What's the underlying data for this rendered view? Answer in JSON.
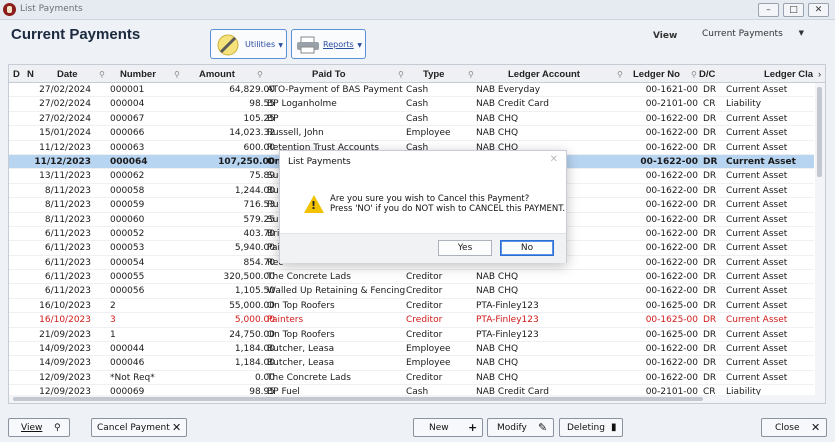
{
  "window": {
    "title": "List Payments",
    "controls": [
      "minimize",
      "maximize",
      "close"
    ]
  },
  "header": {
    "title": "Current Payments",
    "utilities_label": "Utilities",
    "reports_label": "Reports",
    "view_label": "View",
    "view_value": "Current Payments"
  },
  "columns": [
    "D",
    "N",
    "Date",
    "Number",
    "Amount",
    "Paid To",
    "Type",
    "Ledger Account",
    "Ledger No",
    "D/C",
    "Ledger Cla"
  ],
  "rows": [
    {
      "date": "27/02/2024",
      "number": "000001",
      "amount": "64,829.00",
      "paid_to": "ATO-Payment of BAS Payment",
      "type": "Cash",
      "ledger": "NAB Everyday",
      "ledger_no": "00-1621-00",
      "dc": "DR",
      "cls": "Current Asset",
      "state": "normal"
    },
    {
      "date": "27/02/2024",
      "number": "000004",
      "amount": "98.55",
      "paid_to": "BP Loganholme",
      "type": "Cash",
      "ledger": "NAB Credit Card",
      "ledger_no": "00-2101-00",
      "dc": "CR",
      "cls": "Liability",
      "state": "normal"
    },
    {
      "date": "27/02/2024",
      "number": "000067",
      "amount": "105.25",
      "paid_to": "BP",
      "type": "Cash",
      "ledger": "NAB CHQ",
      "ledger_no": "00-1622-00",
      "dc": "DR",
      "cls": "Current Asset",
      "state": "normal"
    },
    {
      "date": "15/01/2024",
      "number": "000066",
      "amount": "14,023.32",
      "paid_to": "Russell, John",
      "type": "Employee",
      "ledger": "NAB CHQ",
      "ledger_no": "00-1622-00",
      "dc": "DR",
      "cls": "Current Asset",
      "state": "normal"
    },
    {
      "date": "11/12/2023",
      "number": "000063",
      "amount": "600.00",
      "paid_to": "Retention Trust Accounts",
      "type": "Cash",
      "ledger": "NAB CHQ",
      "ledger_no": "00-1622-00",
      "dc": "DR",
      "cls": "Current Asset",
      "state": "normal"
    },
    {
      "date": "11/12/2023",
      "number": "000064",
      "amount": "107,250.00",
      "paid_to": "On",
      "type": "",
      "ledger": "",
      "ledger_no": "00-1622-00",
      "dc": "DR",
      "cls": "Current Asset",
      "state": "selected"
    },
    {
      "date": "13/11/2023",
      "number": "000062",
      "amount": "75.89",
      "paid_to": "Sur",
      "type": "",
      "ledger": "",
      "ledger_no": "00-1622-00",
      "dc": "DR",
      "cls": "Current Asset",
      "state": "normal"
    },
    {
      "date": "8/11/2023",
      "number": "000058",
      "amount": "1,244.00",
      "paid_to": "But",
      "type": "",
      "ledger": "",
      "ledger_no": "00-1622-00",
      "dc": "DR",
      "cls": "Current Asset",
      "state": "normal"
    },
    {
      "date": "8/11/2023",
      "number": "000059",
      "amount": "716.53",
      "paid_to": "Rus",
      "type": "",
      "ledger": "",
      "ledger_no": "00-1622-00",
      "dc": "DR",
      "cls": "Current Asset",
      "state": "normal"
    },
    {
      "date": "8/11/2023",
      "number": "000060",
      "amount": "579.25",
      "paid_to": "Sur",
      "type": "",
      "ledger": "",
      "ledger_no": "00-1622-00",
      "dc": "DR",
      "cls": "Current Asset",
      "state": "normal"
    },
    {
      "date": "6/11/2023",
      "number": "000052",
      "amount": "403.70",
      "paid_to": "Bri",
      "type": "",
      "ledger": "",
      "ledger_no": "00-1622-00",
      "dc": "DR",
      "cls": "Current Asset",
      "state": "normal"
    },
    {
      "date": "6/11/2023",
      "number": "000053",
      "amount": "5,940.00",
      "paid_to": "Pai",
      "type": "",
      "ledger": "",
      "ledger_no": "00-1622-00",
      "dc": "DR",
      "cls": "Current Asset",
      "state": "normal"
    },
    {
      "date": "6/11/2023",
      "number": "000054",
      "amount": "854.70",
      "paid_to": "Rec",
      "type": "",
      "ledger": "",
      "ledger_no": "00-1622-00",
      "dc": "DR",
      "cls": "Current Asset",
      "state": "normal"
    },
    {
      "date": "6/11/2023",
      "number": "000055",
      "amount": "320,500.00",
      "paid_to": "The Concrete Lads",
      "type": "Creditor",
      "ledger": "NAB CHQ",
      "ledger_no": "00-1622-00",
      "dc": "DR",
      "cls": "Current Asset",
      "state": "normal"
    },
    {
      "date": "6/11/2023",
      "number": "000056",
      "amount": "1,105.50",
      "paid_to": "Walled Up Retaining & Fencing",
      "type": "Creditor",
      "ledger": "NAB CHQ",
      "ledger_no": "00-1622-00",
      "dc": "DR",
      "cls": "Current Asset",
      "state": "normal"
    },
    {
      "date": "16/10/2023",
      "number": "2",
      "amount": "55,000.00",
      "paid_to": "On Top Roofers",
      "type": "Creditor",
      "ledger": "PTA-Finley123",
      "ledger_no": "00-1625-00",
      "dc": "DR",
      "cls": "Current Asset",
      "state": "normal"
    },
    {
      "date": "16/10/2023",
      "number": "3",
      "amount": "5,000.00",
      "paid_to": "Painters",
      "type": "Creditor",
      "ledger": "PTA-Finley123",
      "ledger_no": "00-1625-00",
      "dc": "DR",
      "cls": "Current Asset",
      "state": "cancelled"
    },
    {
      "date": "21/09/2023",
      "number": "1",
      "amount": "24,750.00",
      "paid_to": "On Top Roofers",
      "type": "Creditor",
      "ledger": "PTA-Finley123",
      "ledger_no": "00-1625-00",
      "dc": "DR",
      "cls": "Current Asset",
      "state": "normal"
    },
    {
      "date": "14/09/2023",
      "number": "000044",
      "amount": "1,184.00",
      "paid_to": "Butcher, Leasa",
      "type": "Employee",
      "ledger": "NAB CHQ",
      "ledger_no": "00-1622-00",
      "dc": "DR",
      "cls": "Current Asset",
      "state": "normal"
    },
    {
      "date": "14/09/2023",
      "number": "000046",
      "amount": "1,184.00",
      "paid_to": "Butcher, Leasa",
      "type": "Employee",
      "ledger": "NAB CHQ",
      "ledger_no": "00-1622-00",
      "dc": "DR",
      "cls": "Current Asset",
      "state": "normal"
    },
    {
      "date": "12/09/2023",
      "number": "*Not Req*",
      "amount": "0.00",
      "paid_to": "The Concrete Lads",
      "type": "Creditor",
      "ledger": "NAB CHQ",
      "ledger_no": "00-1622-00",
      "dc": "DR",
      "cls": "Current Asset",
      "state": "normal"
    },
    {
      "date": "12/09/2023",
      "number": "000069",
      "amount": "98.95",
      "paid_to": "BP Fuel",
      "type": "Cash",
      "ledger": "NAB Credit Card",
      "ledger_no": "00-2101-00",
      "dc": "CR",
      "cls": "Liability",
      "state": "normal"
    }
  ],
  "footer": {
    "view": "View",
    "cancel_payment": "Cancel Payment",
    "new": "New",
    "modify": "Modify",
    "deleting": "Deleting",
    "close": "Close"
  },
  "dialog": {
    "title": "List Payments",
    "line1": "Are you sure you wish to Cancel this Payment?",
    "line2": "Press 'NO' if you do NOT wish to CANCEL this PAYMENT.",
    "yes": "Yes",
    "no": "No"
  }
}
